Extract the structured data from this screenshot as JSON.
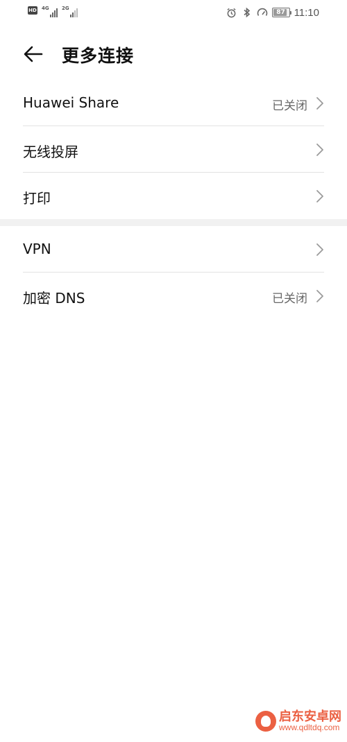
{
  "status_bar": {
    "hd": "HD",
    "sim1_network": "4G",
    "sim2_network": "2G",
    "battery_level": "87",
    "time": "11:10",
    "icons": [
      "alarm-icon",
      "bluetooth-icon",
      "speed-icon",
      "battery-icon"
    ]
  },
  "header": {
    "title": "更多连接",
    "back_icon": "arrow-left-icon"
  },
  "sections": [
    {
      "items": [
        {
          "label": "Huawei Share",
          "status": "已关闭"
        },
        {
          "label": "无线投屏",
          "status": ""
        },
        {
          "label": "打印",
          "status": ""
        }
      ]
    },
    {
      "items": [
        {
          "label": "VPN",
          "status": ""
        },
        {
          "label": "加密 DNS",
          "status": "已关闭"
        }
      ]
    }
  ],
  "watermark": {
    "name": "启东安卓网",
    "url": "www.qdltdq.com"
  },
  "colors": {
    "background": "#ffffff",
    "divider": "#e2e2e2",
    "section_gap": "#f1f1f1",
    "status_text": "#666666",
    "chevron": "#9a9a9a",
    "watermark": "#e94f2e"
  }
}
